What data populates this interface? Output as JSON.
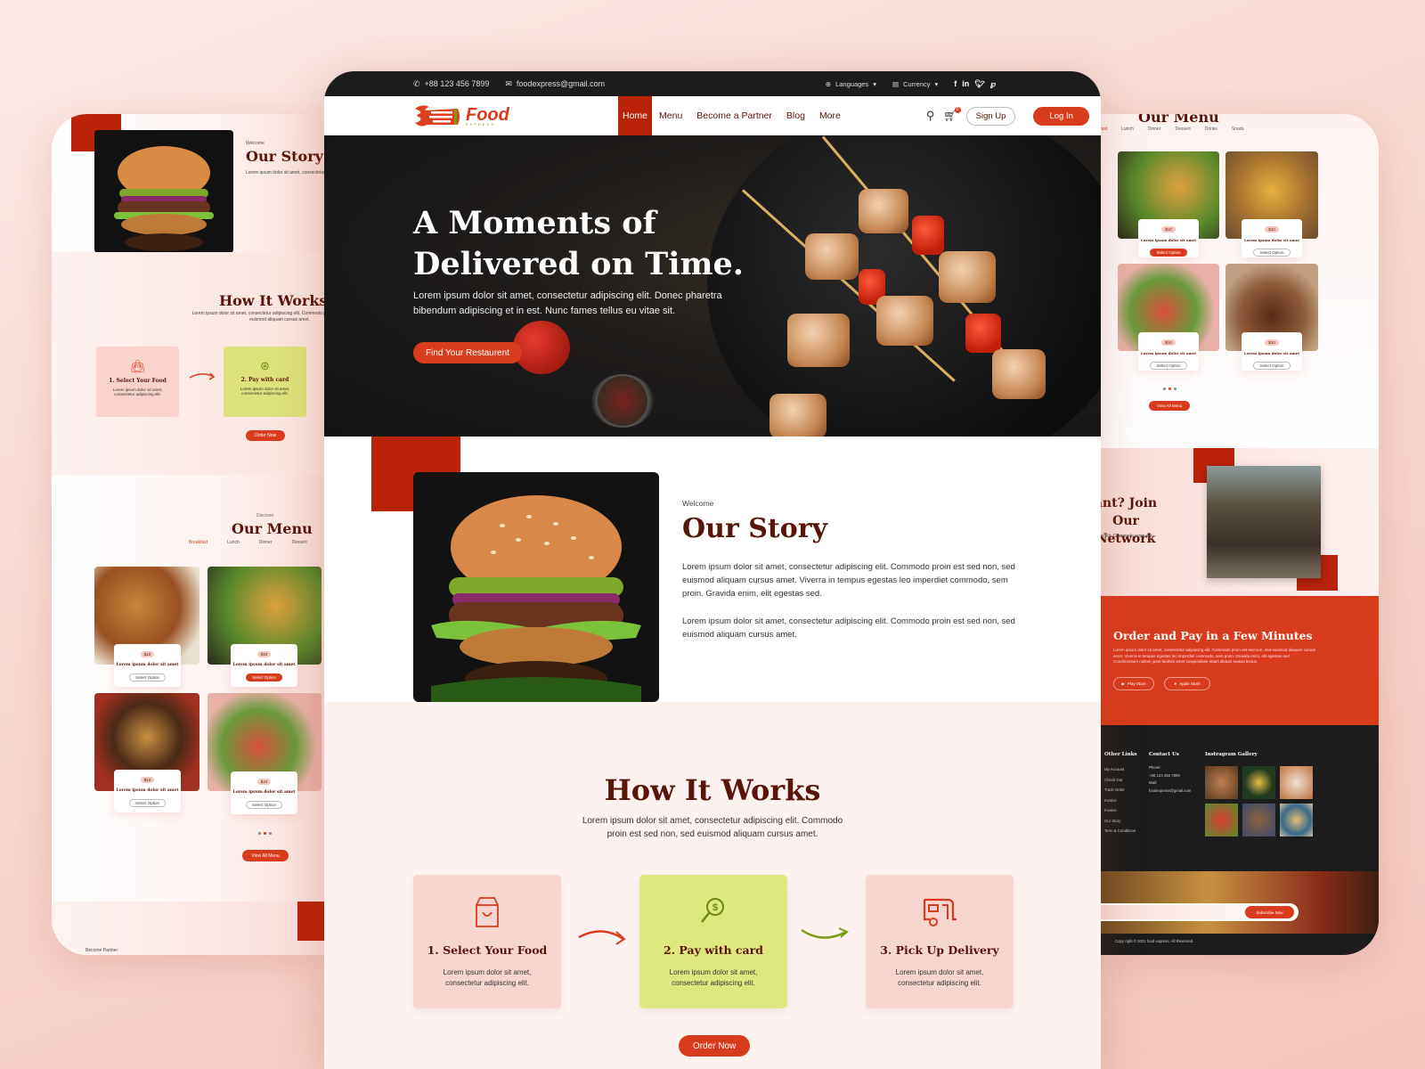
{
  "topbar": {
    "phone": "+88 123 456 7899",
    "email": "foodexpress@gmail.com",
    "languages": "Languages",
    "currency": "Currency",
    "social": [
      "facebook-icon",
      "linkedin-icon",
      "twitter-icon",
      "pinterest-icon"
    ]
  },
  "nav": {
    "logo_text": "Food",
    "logo_sub": "EXPRESS",
    "links": [
      "Home",
      "Menu",
      "Become a Partner",
      "Blog",
      "More"
    ],
    "active": "Home",
    "cart_count": "0",
    "signup": "Sign Up",
    "login": "Log In"
  },
  "hero": {
    "title": "A Moments of Delivered on Time.",
    "text": "Lorem ipsum dolor sit amet, consectetur adipiscing elit. Donec pharetra bibendum adipiscing et in est. Nunc fames tellus eu vitae sit.",
    "cta": "Find Your Restaurent"
  },
  "story": {
    "eyebrow": "Welcome",
    "title": "Our Story",
    "p1": "Lorem ipsum dolor sit amet, consectetur adipiscing elit. Commodo proin est sed non, sed euismod aliquam cursus amet. Viverra in tempus egestas leo imperdiet commodo, sem proin. Gravida enim, elit egestas sed.",
    "p2": "Lorem ipsum dolor sit amet, consectetur adipiscing elit. Commodo proin est sed non, sed euismod aliquam cursus amet."
  },
  "how": {
    "title": "How It Works",
    "text": "Lorem ipsum dolor sit amet, consectetur adipiscing elit. Commodo proin est sed non, sed euismod aliquam cursus amet.",
    "steps": [
      {
        "title": "1. Select Your Food",
        "text": "Lorem ipsum dolor sit amet, consectetur adipiscing elit.",
        "icon": "shopping-bag-icon"
      },
      {
        "title": "2. Pay with card",
        "text": "Lorem ipsum dolor sit amet, consectetur adipiscing elit.",
        "icon": "dollar-search-icon"
      },
      {
        "title": "3. Pick Up Delivery",
        "text": "Lorem ipsum dolor sit amet, consectetur adipiscing elit.",
        "icon": "delivery-van-icon"
      }
    ],
    "order": "Order Now",
    "order_now_small": "Order Now"
  },
  "menu": {
    "eyebrow": "Discover",
    "title": "Our Menu",
    "tabs": [
      "Breakfast",
      "Lunch",
      "Dinner",
      "Dessert",
      "Drinks",
      "Snack"
    ],
    "active_tab": "Breakfast",
    "item_price": "$10",
    "item_title": "Lorem ipsum dolor sit amet",
    "select": "Select Option",
    "view_all": "View All Menu"
  },
  "partner": {
    "eyebrow": "Become Partner",
    "title_fragment_1": "ant? Join Our",
    "title_fragment_2": "Network",
    "text_fragment": "cing elit. Commodo proin est"
  },
  "app": {
    "title": "Order and Pay in a Few Minutes",
    "text": "Lorem ipsum dolor sit amet, consectetur adipiscing elit. Commodo proin est sed non, sed euismod aliquam cursus amet. Viverra in tempus egestas leo imperdiet commodo, sem proin. Gravida enim, elit egestas sed. Condimentum nullam justo facilisis amet suspendisse etiam dictum massa lectus.",
    "play": "Play Store",
    "apple": "Apple Store"
  },
  "footer": {
    "other_links_title": "Other Links",
    "other_links": [
      "My Account",
      "Check Out",
      "Track Order",
      "Invoice",
      "Invoice",
      "Our Story",
      "Term & Conditions"
    ],
    "contact_title": "Contact Us",
    "phone_label": "Phone:",
    "phone": "+88 123 456 7899",
    "mail_label": "Mail:",
    "mail": "foodexpress@gmail.com",
    "gallery_title": "Instragram Gallery",
    "subscribe": "Subscribe Now",
    "copyright": "Copy right © 2021 food express. All Reversed."
  },
  "colors": {
    "accent": "#d93c1c",
    "dark_red": "#b8230a",
    "maroon": "#5a1408",
    "lime": "#dde87e",
    "pink": "#f8d6d0"
  }
}
